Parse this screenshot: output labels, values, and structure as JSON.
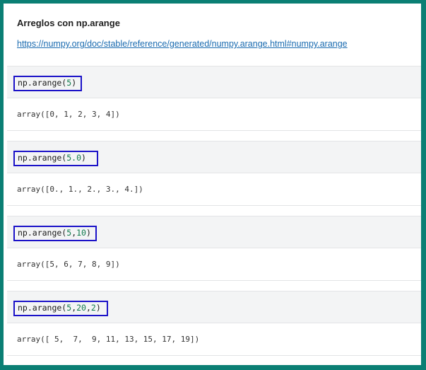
{
  "header": {
    "title": "Arreglos con np.arange",
    "link_text": "https://numpy.org/doc/stable/reference/generated/numpy.arange.html#numpy.arange"
  },
  "cells": [
    {
      "code_prefix": "np.arange(",
      "code_args": [
        {
          "t": "5",
          "num": true
        }
      ],
      "code_suffix": ")",
      "output": "array([0, 1, 2, 3, 4])"
    },
    {
      "code_prefix": "np.arange(",
      "code_args": [
        {
          "t": "5.0",
          "num": true
        }
      ],
      "code_suffix": ")",
      "output": "array([0., 1., 2., 3., 4.])"
    },
    {
      "code_prefix": "np.arange(",
      "code_args": [
        {
          "t": "5",
          "num": true
        },
        {
          "t": ",",
          "num": false
        },
        {
          "t": "10",
          "num": true
        }
      ],
      "code_suffix": ")",
      "output": "array([5, 6, 7, 8, 9])"
    },
    {
      "code_prefix": "np.arange(",
      "code_args": [
        {
          "t": "5",
          "num": true
        },
        {
          "t": ",",
          "num": false
        },
        {
          "t": "20",
          "num": true
        },
        {
          "t": ",",
          "num": false
        },
        {
          "t": "2",
          "num": true
        }
      ],
      "code_suffix": ")",
      "output": "array([ 5,  7,  9, 11, 13, 15, 17, 19])"
    }
  ]
}
